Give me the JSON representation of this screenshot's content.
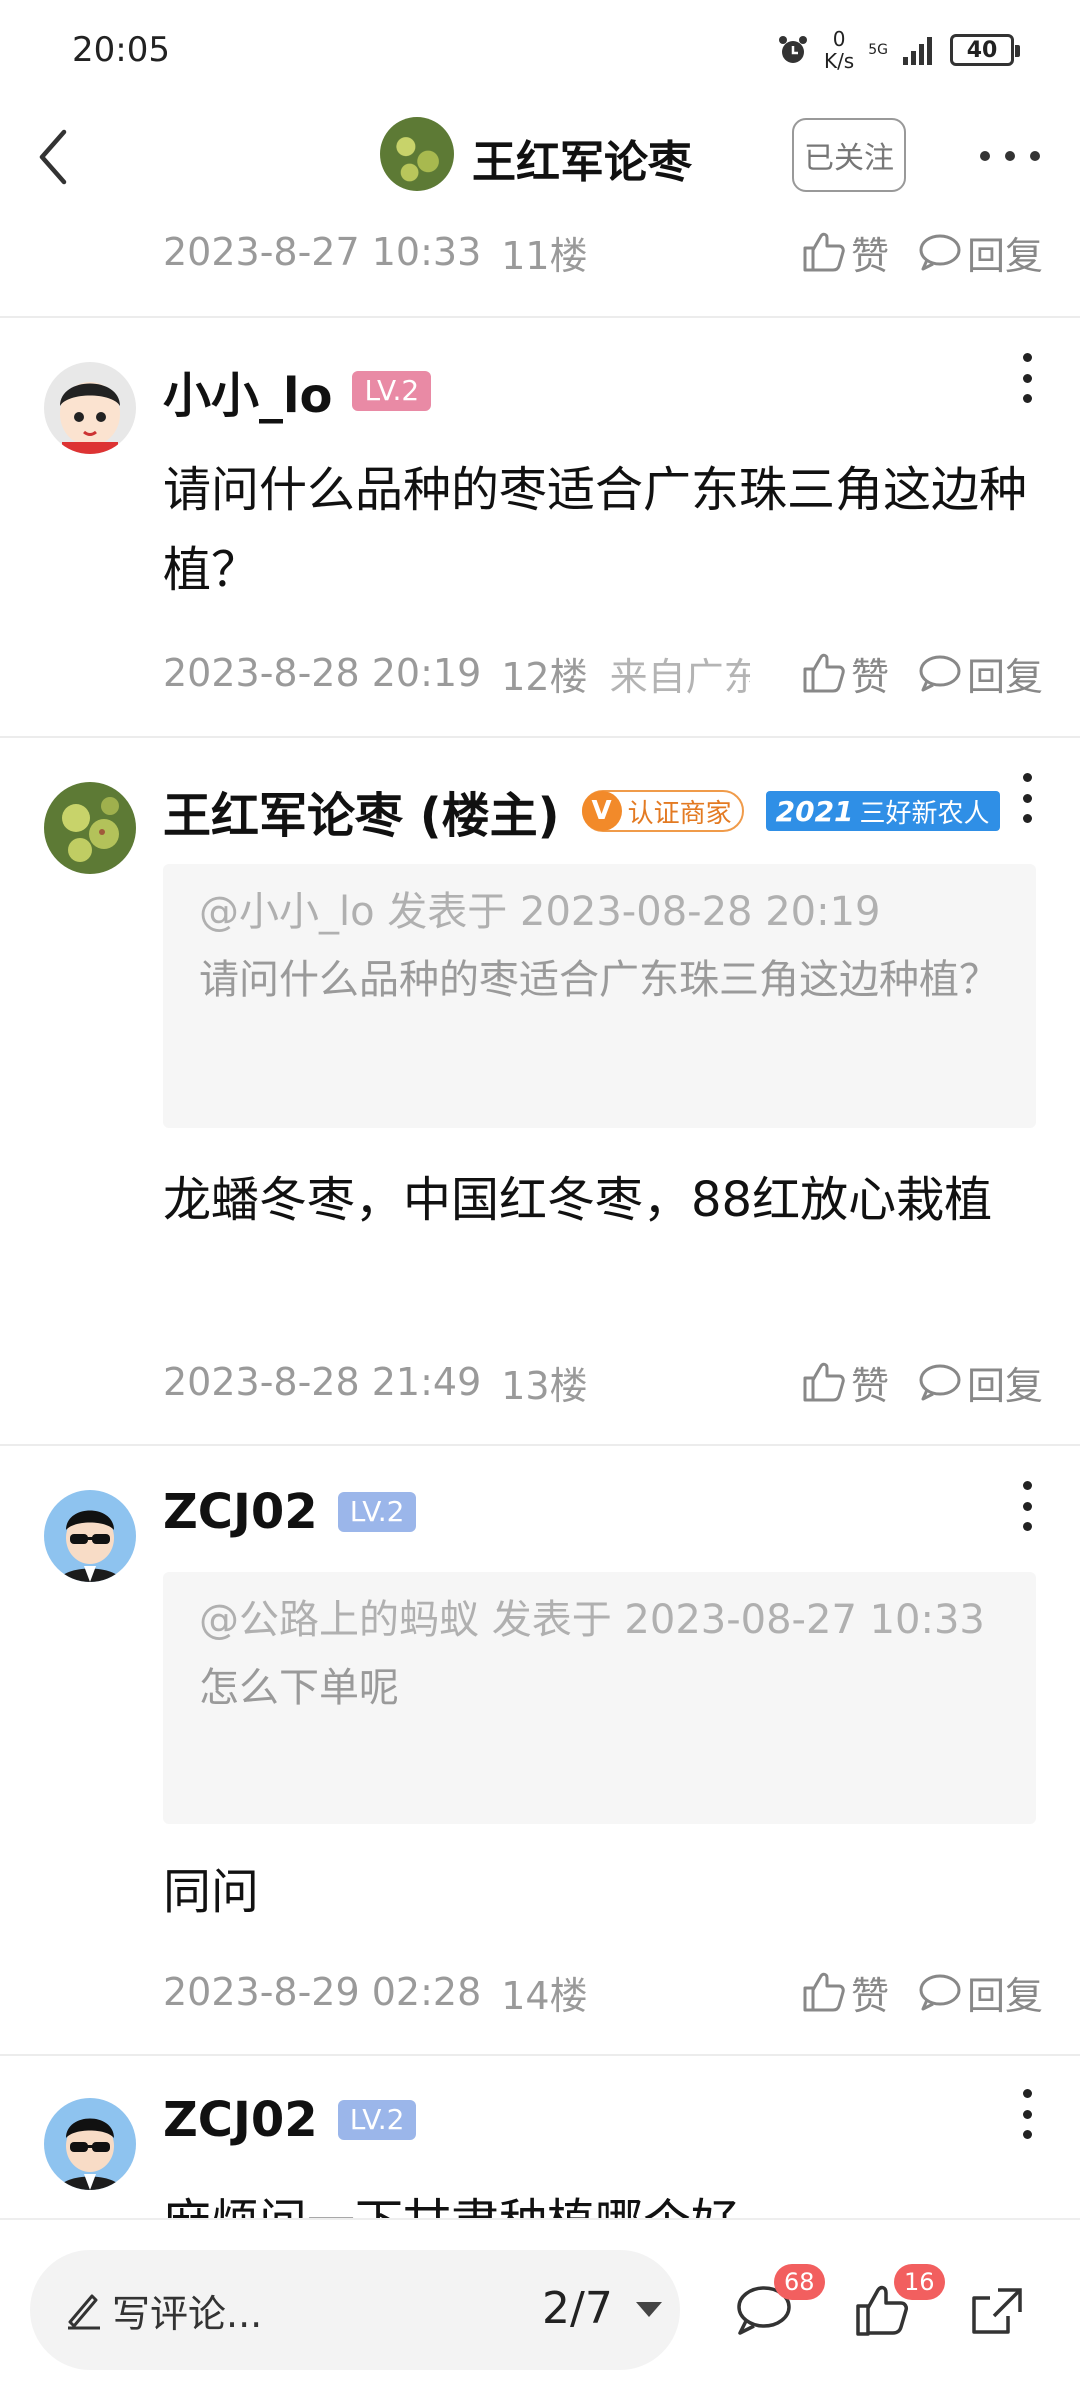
{
  "status_bar": {
    "time": "20:05",
    "speed_value": "0",
    "speed_unit": "K/s",
    "network": "5G",
    "battery": "40"
  },
  "header": {
    "title": "王红军论枣",
    "follow_label": "已关注"
  },
  "actions": {
    "like": "赞",
    "reply": "回复"
  },
  "top_meta": {
    "date": "2023-8-27 10:33",
    "floor": "11楼"
  },
  "comments": [
    {
      "user": "小小_lo",
      "level": "LV.2",
      "text": "请问什么品种的枣适合广东珠三角这边种植？",
      "date": "2023-8-28 20:19",
      "floor": "12楼",
      "from": "来自广东"
    },
    {
      "user": "王红军论枣 (楼主)",
      "cert_badge": "认证商家",
      "cert_letter": "V",
      "year_badge_year": "2021",
      "year_badge_text": "三好新农人",
      "quote_head": "@小小_lo 发表于 2023-08-28 20:19",
      "quote_text": "请问什么品种的枣适合广东珠三角这边种植？",
      "text": "龙蟠冬枣，中国红冬枣，88红放心栽植",
      "date": "2023-8-28 21:49",
      "floor": "13楼"
    },
    {
      "user": "ZCJ02",
      "level": "LV.2",
      "quote_head": "@公路上的蚂蚁 发表于 2023-08-27 10:33",
      "quote_text": "怎么下单呢",
      "text": "同问",
      "date": "2023-8-29 02:28",
      "floor": "14楼"
    },
    {
      "user": "ZCJ02",
      "level": "LV.2",
      "text": "麻烦问一下甘肃种植哪个好"
    }
  ],
  "bottom_bar": {
    "input_placeholder": "写评论...",
    "page": "2/7",
    "comment_count": "68",
    "like_count": "16"
  },
  "colors": {
    "level_pink": "#e98aa5",
    "level_blue": "#9bb6ea",
    "badge_red": "#f25f5f",
    "cert_orange": "#f28a2a",
    "year_blue": "#2f8fe6"
  }
}
